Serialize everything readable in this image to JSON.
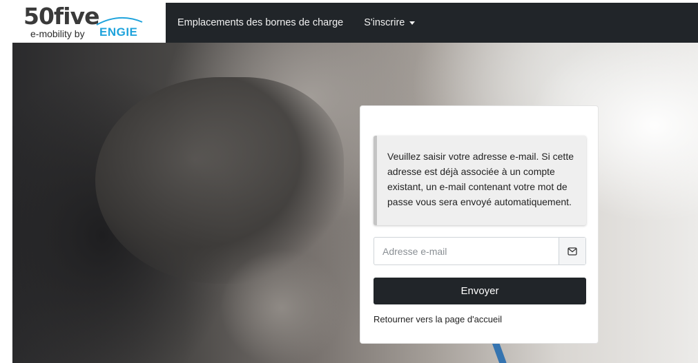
{
  "logo": {
    "main": "50five",
    "sub": "e-mobility by",
    "brand": "ENGIE"
  },
  "navbar": {
    "items": [
      {
        "label": "Emplacements des bornes de charge"
      },
      {
        "label": "S'inscrire"
      }
    ]
  },
  "form": {
    "info_text": "Veuillez saisir votre adresse e-mail. Si cette adresse est déjà associée à un compte existant, un e-mail contenant votre mot de passe vous sera envoyé automatiquement.",
    "email_placeholder": "Adresse e-mail",
    "email_value": "",
    "submit_label": "Envoyer",
    "back_link": "Retourner vers la page d'accueil"
  },
  "icons": {
    "email_addon": "envelope-icon",
    "dropdown": "caret-down-icon"
  },
  "colors": {
    "navbar_bg": "#212529",
    "button_bg": "#212529",
    "brand_blue": "#1ea3dc",
    "alert_bg": "#efefef"
  }
}
